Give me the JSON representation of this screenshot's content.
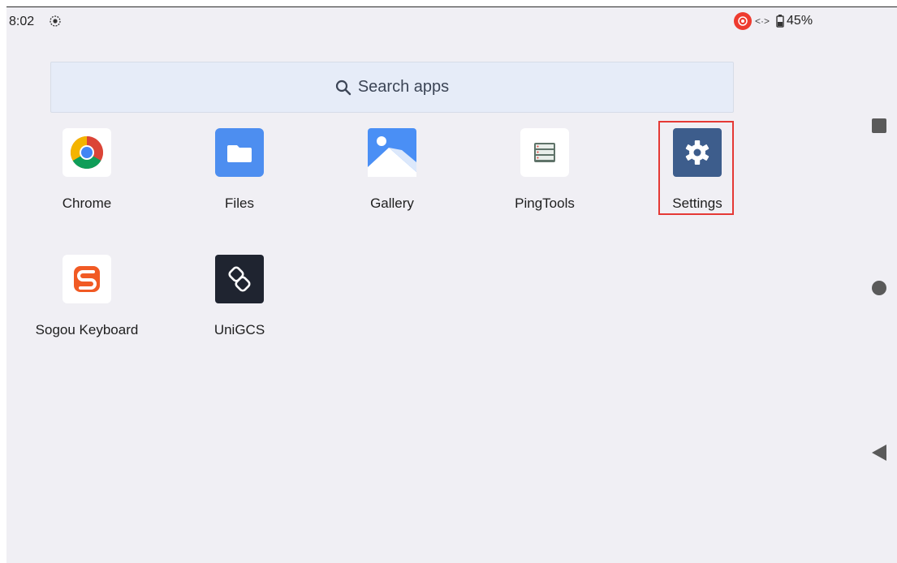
{
  "status_bar": {
    "time": "8:02",
    "battery": "45%",
    "accent_red": "#ee3b2f"
  },
  "search": {
    "label": "Search apps",
    "icon": "search-icon"
  },
  "apps": [
    {
      "label": "Chrome",
      "icon": "chrome-icon"
    },
    {
      "label": "Files",
      "icon": "folder-icon"
    },
    {
      "label": "Gallery",
      "icon": "image-icon"
    },
    {
      "label": "PingTools",
      "icon": "server-icon"
    },
    {
      "label": "Settings",
      "icon": "gear-icon",
      "highlighted": true
    },
    {
      "label": "Sogou Keyboard",
      "icon": "sogou-icon"
    },
    {
      "label": "UniGCS",
      "icon": "unigcs-icon"
    }
  ],
  "nav_bar": {
    "buttons": [
      "recents-button",
      "home-button",
      "back-button"
    ]
  },
  "colors": {
    "background": "#f0eff4",
    "highlight_border": "#e53935"
  }
}
